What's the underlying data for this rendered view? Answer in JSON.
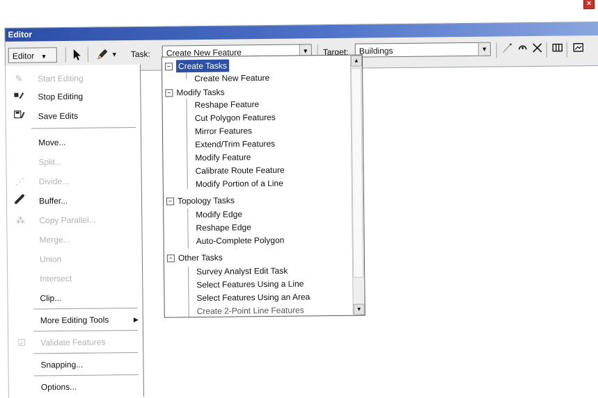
{
  "window": {
    "title": "Editor",
    "close_glyph": "×"
  },
  "toolbar": {
    "editor_menu_label": "Editor",
    "editor_menu_arrow": "▼",
    "pointer_icon": "pointer-icon",
    "sketch_icon": "pencil-icon",
    "sketch_arrow": "▼",
    "task_label": "Task:",
    "task_value": "Create New Feature",
    "target_label": "Target:",
    "target_value": "Buildings",
    "dropdown_glyph": "▼",
    "right_icons": [
      "edit-vertices-icon",
      "rotate-icon",
      "split-icon",
      "attributes-icon",
      "sketch-properties-icon"
    ]
  },
  "editor_menu": {
    "items": [
      {
        "label": "Start Editing",
        "icon": "start-editing-icon",
        "enabled": false
      },
      {
        "label": "Stop Editing",
        "icon": "stop-editing-icon",
        "enabled": true
      },
      {
        "label": "Save Edits",
        "icon": "save-edits-icon",
        "enabled": true
      },
      {
        "label": "Move...",
        "enabled": true
      },
      {
        "label": "Split...",
        "enabled": false
      },
      {
        "label": "Divide...",
        "icon": "divide-icon",
        "enabled": false
      },
      {
        "label": "Buffer...",
        "icon": "buffer-icon",
        "enabled": true
      },
      {
        "label": "Copy Parallel...",
        "icon": "copy-parallel-icon",
        "enabled": false
      },
      {
        "label": "Merge...",
        "enabled": false
      },
      {
        "label": "Union",
        "enabled": false
      },
      {
        "label": "Intersect",
        "enabled": false
      },
      {
        "label": "Clip...",
        "enabled": true
      },
      {
        "label": "More Editing Tools",
        "enabled": true,
        "submenu": true
      },
      {
        "label": "Validate Features",
        "icon": "validate-icon",
        "enabled": false
      },
      {
        "label": "Snapping...",
        "enabled": true
      },
      {
        "label": "Options...",
        "enabled": true
      }
    ]
  },
  "task_list": {
    "groups": [
      {
        "name": "Create Tasks",
        "selected": true,
        "tasks": [
          "Create New Feature"
        ]
      },
      {
        "name": "Modify Tasks",
        "selected": false,
        "tasks": [
          "Reshape Feature",
          "Cut Polygon Features",
          "Mirror Features",
          "Extend/Trim Features",
          "Modify Feature",
          "Calibrate Route Feature",
          "Modify Portion of a Line"
        ]
      },
      {
        "name": "Topology Tasks",
        "selected": false,
        "tasks": [
          "Modify Edge",
          "Reshape Edge",
          "Auto-Complete Polygon"
        ]
      },
      {
        "name": "Other Tasks",
        "selected": false,
        "tasks": [
          "Survey Analyst Edit Task",
          "Select Features Using a Line",
          "Select Features Using an Area",
          "Create 2-Point Line Features"
        ]
      }
    ],
    "toggle_glyph": "−",
    "scroll_up": "▲",
    "scroll_down": "▼"
  }
}
